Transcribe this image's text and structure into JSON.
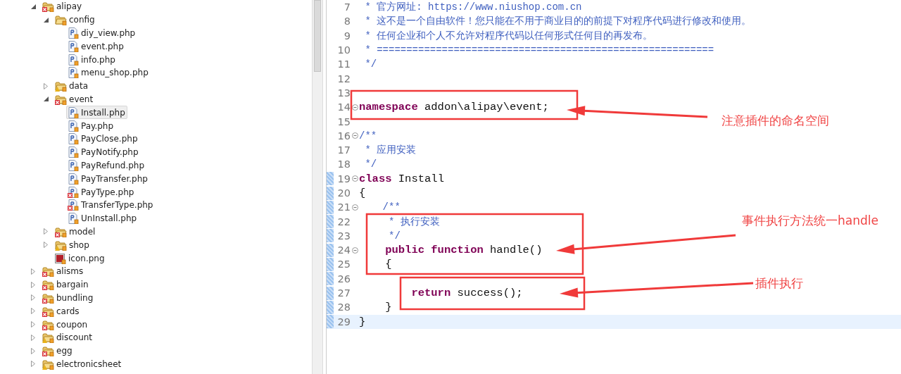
{
  "project_tree": {
    "items": [
      {
        "label": "alipay",
        "kind": "folder",
        "error": true,
        "warning": false,
        "expanded": true,
        "selected": false,
        "children": [
          {
            "label": "config",
            "kind": "folder",
            "error": false,
            "warning": false,
            "expanded": true,
            "selected": false,
            "children": [
              {
                "label": "diy_view.php",
                "kind": "php",
                "error": false,
                "warning": false,
                "selected": false
              },
              {
                "label": "event.php",
                "kind": "php",
                "error": false,
                "warning": false,
                "selected": false
              },
              {
                "label": "info.php",
                "kind": "php",
                "error": false,
                "warning": false,
                "selected": false
              },
              {
                "label": "menu_shop.php",
                "kind": "php",
                "error": false,
                "warning": false,
                "selected": false
              }
            ]
          },
          {
            "label": "data",
            "kind": "folder",
            "error": false,
            "warning": true,
            "expanded": false,
            "selected": false
          },
          {
            "label": "event",
            "kind": "folder",
            "error": true,
            "warning": false,
            "expanded": true,
            "selected": false,
            "children": [
              {
                "label": "Install.php",
                "kind": "php",
                "error": false,
                "warning": false,
                "selected": true
              },
              {
                "label": "Pay.php",
                "kind": "php",
                "error": false,
                "warning": false,
                "selected": false
              },
              {
                "label": "PayClose.php",
                "kind": "php",
                "error": false,
                "warning": false,
                "selected": false
              },
              {
                "label": "PayNotify.php",
                "kind": "php",
                "error": false,
                "warning": false,
                "selected": false
              },
              {
                "label": "PayRefund.php",
                "kind": "php",
                "error": false,
                "warning": false,
                "selected": false
              },
              {
                "label": "PayTransfer.php",
                "kind": "php",
                "error": false,
                "warning": false,
                "selected": false
              },
              {
                "label": "PayType.php",
                "kind": "php",
                "error": true,
                "warning": false,
                "selected": false
              },
              {
                "label": "TransferType.php",
                "kind": "php",
                "error": true,
                "warning": false,
                "selected": false
              },
              {
                "label": "UnInstall.php",
                "kind": "php",
                "error": false,
                "warning": false,
                "selected": false
              }
            ]
          },
          {
            "label": "model",
            "kind": "folder",
            "error": true,
            "warning": false,
            "expanded": false,
            "selected": false
          },
          {
            "label": "shop",
            "kind": "folder",
            "error": false,
            "warning": true,
            "expanded": false,
            "selected": false
          },
          {
            "label": "icon.png",
            "kind": "image",
            "error": false,
            "warning": false,
            "selected": false
          }
        ]
      },
      {
        "label": "alisms",
        "kind": "folder",
        "error": true,
        "warning": false,
        "expanded": false,
        "selected": false
      },
      {
        "label": "bargain",
        "kind": "folder",
        "error": true,
        "warning": false,
        "expanded": false,
        "selected": false
      },
      {
        "label": "bundling",
        "kind": "folder",
        "error": true,
        "warning": false,
        "expanded": false,
        "selected": false
      },
      {
        "label": "cards",
        "kind": "folder",
        "error": true,
        "warning": false,
        "expanded": false,
        "selected": false
      },
      {
        "label": "coupon",
        "kind": "folder",
        "error": true,
        "warning": false,
        "expanded": false,
        "selected": false
      },
      {
        "label": "discount",
        "kind": "folder",
        "error": false,
        "warning": true,
        "expanded": false,
        "selected": false
      },
      {
        "label": "egg",
        "kind": "folder",
        "error": true,
        "warning": false,
        "expanded": false,
        "selected": false
      },
      {
        "label": "electronicsheet",
        "kind": "folder",
        "error": false,
        "warning": true,
        "expanded": false,
        "selected": false
      }
    ]
  },
  "editor": {
    "lines": [
      {
        "n": "7",
        "fold": false,
        "changed": false,
        "current": false,
        "tokens": [
          {
            "kind": "comment",
            "text": " * 官方网址: https://www.niushop.com.cn"
          }
        ]
      },
      {
        "n": "8",
        "fold": false,
        "changed": false,
        "current": false,
        "tokens": [
          {
            "kind": "comment",
            "text": " * 这不是一个自由软件！您只能在不用于商业目的的前提下对程序代码进行修改和使用。"
          }
        ]
      },
      {
        "n": "9",
        "fold": false,
        "changed": false,
        "current": false,
        "tokens": [
          {
            "kind": "comment",
            "text": " * 任何企业和个人不允许对程序代码以任何形式任何目的再发布。"
          }
        ]
      },
      {
        "n": "10",
        "fold": false,
        "changed": false,
        "current": false,
        "tokens": [
          {
            "kind": "comment",
            "text": " * ========================================================="
          }
        ]
      },
      {
        "n": "11",
        "fold": false,
        "changed": false,
        "current": false,
        "tokens": [
          {
            "kind": "comment",
            "text": " */"
          }
        ]
      },
      {
        "n": "12",
        "fold": false,
        "changed": false,
        "current": false
      },
      {
        "n": "13",
        "fold": false,
        "changed": false,
        "current": false
      },
      {
        "n": "14",
        "fold": true,
        "changed": false,
        "current": false,
        "tokens": [
          {
            "kind": "keyword",
            "text": "namespace"
          },
          {
            "kind": "plain",
            "text": " addon\\alipay\\event;"
          }
        ]
      },
      {
        "n": "15",
        "fold": false,
        "changed": false,
        "current": false
      },
      {
        "n": "16",
        "fold": true,
        "changed": false,
        "current": false,
        "tokens": [
          {
            "kind": "comment",
            "text": "/**"
          }
        ]
      },
      {
        "n": "17",
        "fold": false,
        "changed": false,
        "current": false,
        "tokens": [
          {
            "kind": "comment",
            "text": " * 应用安装"
          }
        ]
      },
      {
        "n": "18",
        "fold": false,
        "changed": false,
        "current": false,
        "tokens": [
          {
            "kind": "comment",
            "text": " */"
          }
        ]
      },
      {
        "n": "19",
        "fold": true,
        "changed": true,
        "current": false,
        "tokens": [
          {
            "kind": "keyword",
            "text": "class"
          },
          {
            "kind": "plain",
            "text": " Install"
          }
        ]
      },
      {
        "n": "20",
        "fold": false,
        "changed": true,
        "current": false,
        "tokens": [
          {
            "kind": "plain",
            "text": "{"
          }
        ]
      },
      {
        "n": "21",
        "fold": true,
        "changed": true,
        "current": false,
        "tokens": [
          {
            "kind": "comment",
            "text": "    /**"
          }
        ]
      },
      {
        "n": "22",
        "fold": false,
        "changed": true,
        "current": false,
        "tokens": [
          {
            "kind": "comment",
            "text": "     * 执行安装"
          }
        ]
      },
      {
        "n": "23",
        "fold": false,
        "changed": true,
        "current": false,
        "tokens": [
          {
            "kind": "comment",
            "text": "     */"
          }
        ]
      },
      {
        "n": "24",
        "fold": true,
        "changed": true,
        "current": false,
        "tokens": [
          {
            "kind": "keyword",
            "text": "    public function"
          },
          {
            "kind": "plain",
            "text": " handle()"
          }
        ]
      },
      {
        "n": "25",
        "fold": false,
        "changed": true,
        "current": false,
        "tokens": [
          {
            "kind": "plain",
            "text": "    {"
          }
        ]
      },
      {
        "n": "26",
        "fold": false,
        "changed": true,
        "current": false
      },
      {
        "n": "27",
        "fold": false,
        "changed": true,
        "current": false,
        "tokens": [
          {
            "kind": "keyword",
            "text": "        return"
          },
          {
            "kind": "plain",
            "text": " success();"
          }
        ]
      },
      {
        "n": "28",
        "fold": false,
        "changed": true,
        "current": false,
        "tokens": [
          {
            "kind": "plain",
            "text": "    }"
          }
        ]
      },
      {
        "n": "29",
        "fold": false,
        "changed": true,
        "current": true,
        "tokens": [
          {
            "kind": "plain",
            "text": "}"
          }
        ]
      }
    ]
  },
  "annotations": [
    {
      "text": "注意插件的命名空间"
    },
    {
      "text": "事件执行方法统一handle"
    },
    {
      "text": "插件执行"
    }
  ]
}
